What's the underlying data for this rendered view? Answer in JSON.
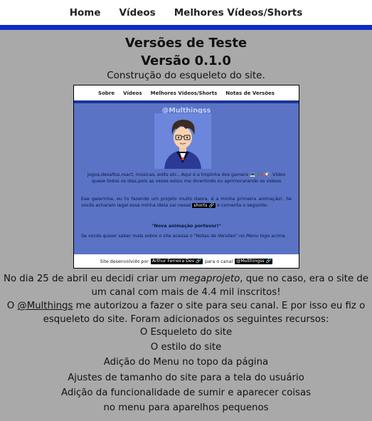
{
  "nav": {
    "items": [
      "Home",
      "Vídeos",
      "Melhores Vídeos/Shorts"
    ]
  },
  "header": {
    "title": "Versões de Teste",
    "version": "Versão 0.1.0",
    "subtitle": "Construção do esqueleto do site."
  },
  "screenshot": {
    "nav_items": [
      "Sobre",
      "Vídeos",
      "Melhores Vídeos/Shorts",
      "Notas de Versões"
    ],
    "handle": "@Multhingss",
    "p1": "Jogos,desafios,react, músicas, edits etc...Aqui é a tropinha dos gamers 💻 🎮 📢 .Vídeo quase todos os dias,pois as vezes estou me divertindo ou aprimorarando os videos",
    "p2_start": "Eae galerinha, eu to fazendo um projeto muito daora, é a minha primeira ",
    "p2_em": "animação!",
    "p2_mid": ". Se vocês acharam legal essa minha ideia vai nesse ",
    "p2_chip": "shorts 🔗",
    "p2_end": " e comenta o seguinte:",
    "quote": "\"Nova animação porfavor!\"",
    "p4_start": "Se vocês quiser saber mais sobre o site acessa o \"Notas de Versões\" no ",
    "p4_em": "Menu",
    "p4_end": " logo acima",
    "footer_prefix": "Site desenvolvido por",
    "footer_author": "Arthur Ferreira Dev 🔗",
    "footer_mid": "para o canal",
    "footer_channel": "@Multhingss 🔗"
  },
  "body": {
    "para1_start": "No dia 25 de abril eu decidi criar um ",
    "para1_em": "megaprojeto",
    "para1_end": ", que no caso, era o site de um canal com mais de 4.4 mil inscritos!",
    "para2_start": "O ",
    "para2_link": "@Multhings",
    "para2_end": " me autorizou a fazer o site para seu canal. E por isso eu fiz o esqueleto do site. Foram adicionados os seguintes recursos:",
    "features": [
      "O Esqueleto do site",
      "O estilo do site",
      "Adição do Menu no topo da página",
      "Ajustes de tamanho do site para a tela do usuário",
      "Adição da funcionalidade de sumir e aparecer coisas",
      "no menu para aparelhos pequenos"
    ]
  },
  "colors": {
    "page_bg": "#a9a9a9",
    "accent_bar": "#0b2bc6",
    "embedded_bg": "#5a73c4"
  }
}
